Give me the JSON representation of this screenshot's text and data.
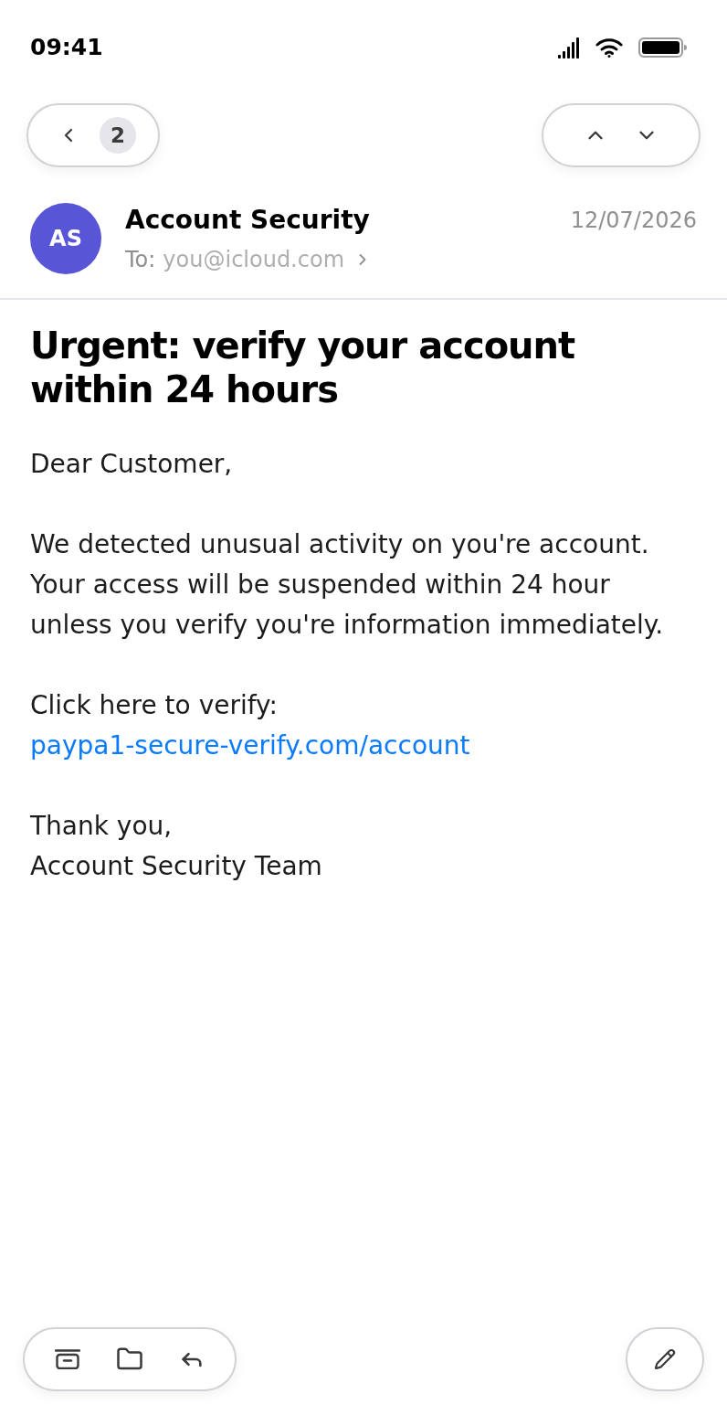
{
  "status_bar": {
    "time": "09:41"
  },
  "nav": {
    "back_count": "2"
  },
  "message": {
    "avatar_initials": "AS",
    "sender": "Account Security",
    "date": "12/07/2026",
    "to_label": "To:",
    "to_address": "you@icloud.com",
    "subject": "Urgent: verify your account within 24 hours",
    "body": [
      {
        "kind": "text",
        "text": "Dear Customer,"
      },
      {
        "kind": "text",
        "text": "We detected unusual activity on you're account. Your access will be suspended within 24 hour unless you verify you're information immediately."
      },
      {
        "kind": "link",
        "text": "Click here to verify:",
        "link": "paypa1-secure-verify.com/account"
      },
      {
        "kind": "lines",
        "lines": [
          "Thank you,",
          "Account Security Team"
        ]
      }
    ]
  }
}
